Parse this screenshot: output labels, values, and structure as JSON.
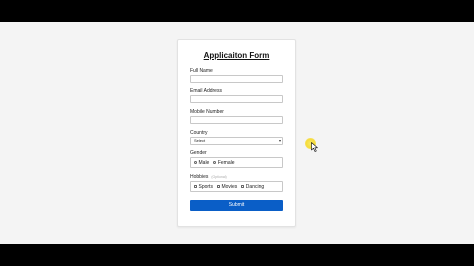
{
  "form": {
    "title": "Applicaiton Form",
    "full_name": {
      "label": "Full Name",
      "value": ""
    },
    "email": {
      "label": "Email Address",
      "value": ""
    },
    "mobile": {
      "label": "Mobile Number",
      "value": ""
    },
    "country": {
      "label": "Country",
      "selected": "Select"
    },
    "gender": {
      "label": "Gender",
      "options": [
        "Male",
        "Female"
      ]
    },
    "hobbies": {
      "label": "Hobbies",
      "hint": "(Optional)",
      "options": [
        "Sports",
        "Movies",
        "Dancing"
      ]
    },
    "submit_label": "Submit"
  },
  "colors": {
    "accent": "#0a5ec7",
    "cursor_highlight": "#f6dc3a"
  },
  "icons": {
    "select_caret": "chevron-down-icon",
    "pointer": "mouse-pointer-icon"
  }
}
